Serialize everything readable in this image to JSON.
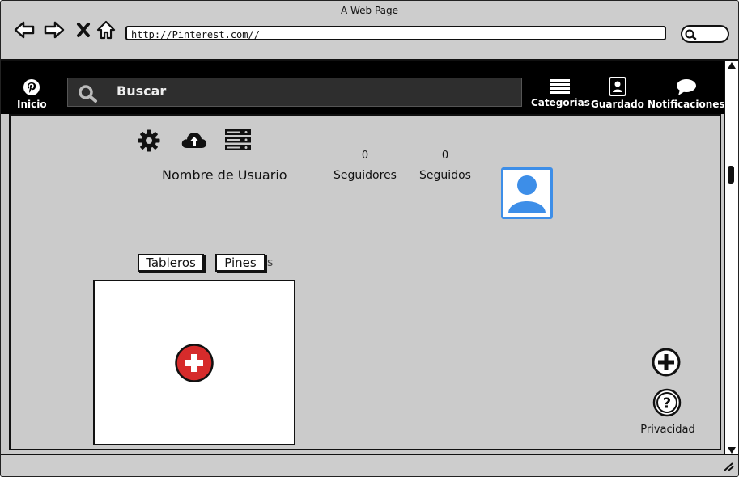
{
  "window": {
    "title": "A Web Page"
  },
  "browser": {
    "url": "http://Pinterest.com//",
    "icons": [
      "back-arrow-icon",
      "forward-arrow-icon",
      "close-x-icon",
      "home-icon",
      "search-icon"
    ]
  },
  "header": {
    "home_label": "Inicio",
    "search_placeholder": "Buscar",
    "categories_label": "Categorias",
    "saved_label": "Guardado",
    "notifications_label": "Notificaciones"
  },
  "profile": {
    "username": "Nombre de Usuario",
    "followers_count": "0",
    "followers_label": "Seguidores",
    "following_count": "0",
    "following_label": "Seguidos",
    "tool_icons": [
      "gear-icon",
      "cloud-upload-icon",
      "server-list-icon"
    ]
  },
  "tabs": {
    "boards_label": "Tableros",
    "pins_label": "Pines",
    "ghost_text": "s"
  },
  "footer": {
    "privacy_label": "Privacidad"
  },
  "colors": {
    "header_bg": "#000000",
    "content_bg": "#cbcbcb",
    "accent_red": "#d62b2b",
    "avatar_blue": "#3d8ee8"
  }
}
